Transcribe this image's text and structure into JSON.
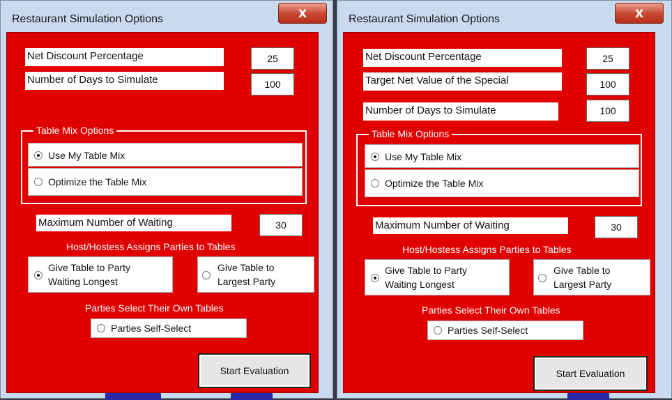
{
  "left": {
    "title": "Restaurant Simulation Options",
    "close_icon": "close-icon",
    "close_glyph": "X",
    "fields": [
      {
        "label": "Net Discount Percentage",
        "value": "25"
      },
      {
        "label": "Number of Days to Simulate",
        "value": "100"
      }
    ],
    "table_mix": {
      "legend": "Table Mix Options",
      "options": [
        "Use My Table Mix",
        "Optimize the Table Mix"
      ],
      "selected": 0
    },
    "waiting": {
      "label": "Maximum Number of Waiting",
      "value": "30"
    },
    "host_header": "Host/Hostess Assigns Parties to Tables",
    "host_options": [
      {
        "line1": "Give Table to Party",
        "line2": "Waiting Longest",
        "selected": true
      },
      {
        "line1": "Give Table to",
        "line2": "Largest Party",
        "selected": false
      }
    ],
    "self_header": "Parties Select Their Own Tables",
    "self_option": "Parties Self-Select",
    "start_button": "Start Evaluation"
  },
  "right": {
    "title": "Restaurant Simulation Options",
    "close_icon": "close-icon",
    "close_glyph": "X",
    "fields": [
      {
        "label": "Net Discount Percentage",
        "value": "25"
      },
      {
        "label": "Target Net Value of the Special",
        "value": "100"
      },
      {
        "label": "Number of Days to Simulate",
        "value": "100"
      }
    ],
    "table_mix": {
      "legend": "Table Mix Options",
      "options": [
        "Use My Table Mix",
        "Optimize the Table Mix"
      ],
      "selected": 0
    },
    "waiting": {
      "label": "Maximum Number of Waiting",
      "value": "30"
    },
    "host_header": "Host/Hostess Assigns Parties to Tables",
    "host_options": [
      {
        "line1": "Give Table to Party",
        "line2": "Waiting Longest",
        "selected": true
      },
      {
        "line1": "Give Table to",
        "line2": "Largest Party",
        "selected": false
      }
    ],
    "self_header": "Parties Select Their Own Tables",
    "self_option": "Parties Self-Select",
    "start_button": "Start Evaluation"
  }
}
